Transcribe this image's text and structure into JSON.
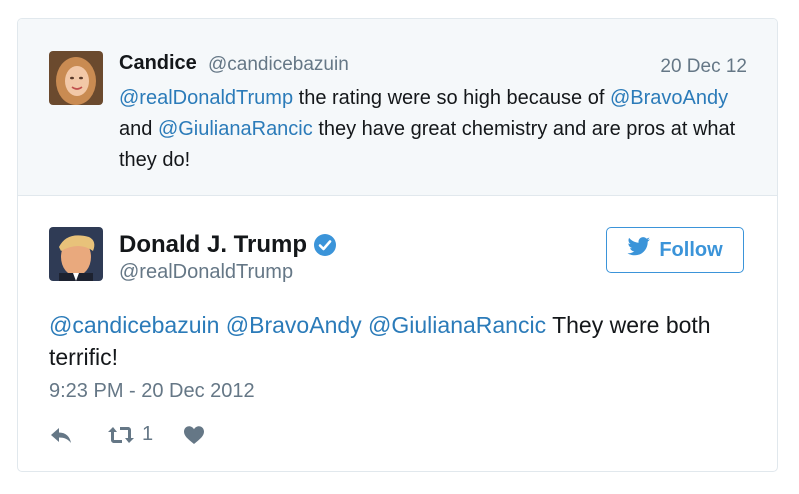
{
  "quoted": {
    "name": "Candice",
    "handle": "@candicebazuin",
    "date": "20 Dec 12",
    "text_parts": [
      {
        "t": "@realDonaldTrump",
        "mention": true
      },
      {
        "t": " the rating were so high because of ",
        "mention": false
      },
      {
        "t": "@BravoAndy",
        "mention": true
      },
      {
        "t": " and ",
        "mention": false
      },
      {
        "t": "@GiulianaRancic",
        "mention": true
      },
      {
        "t": " they have great chemistry and are pros at what they do!",
        "mention": false
      }
    ]
  },
  "tweet": {
    "name": "Donald J. Trump",
    "handle": "@realDonaldTrump",
    "follow_label": "Follow",
    "text_parts": [
      {
        "t": "@candicebazuin",
        "mention": true
      },
      {
        "t": " ",
        "mention": false
      },
      {
        "t": "@BravoAndy",
        "mention": true
      },
      {
        "t": " ",
        "mention": false
      },
      {
        "t": "@GiulianaRancic",
        "mention": true
      },
      {
        "t": " They were both terrific!",
        "mention": false
      }
    ],
    "timestamp": "9:23 PM - 20 Dec 2012",
    "retweet_count": "1"
  },
  "icons": {
    "verified": "verified-badge-icon",
    "twitter": "twitter-bird-icon",
    "reply": "reply-icon",
    "retweet": "retweet-icon",
    "like": "heart-icon"
  },
  "colors": {
    "mention": "#2b7bb9",
    "follow": "#3b94d9",
    "quoted_bg": "#f5f8fa",
    "muted": "#657786"
  }
}
